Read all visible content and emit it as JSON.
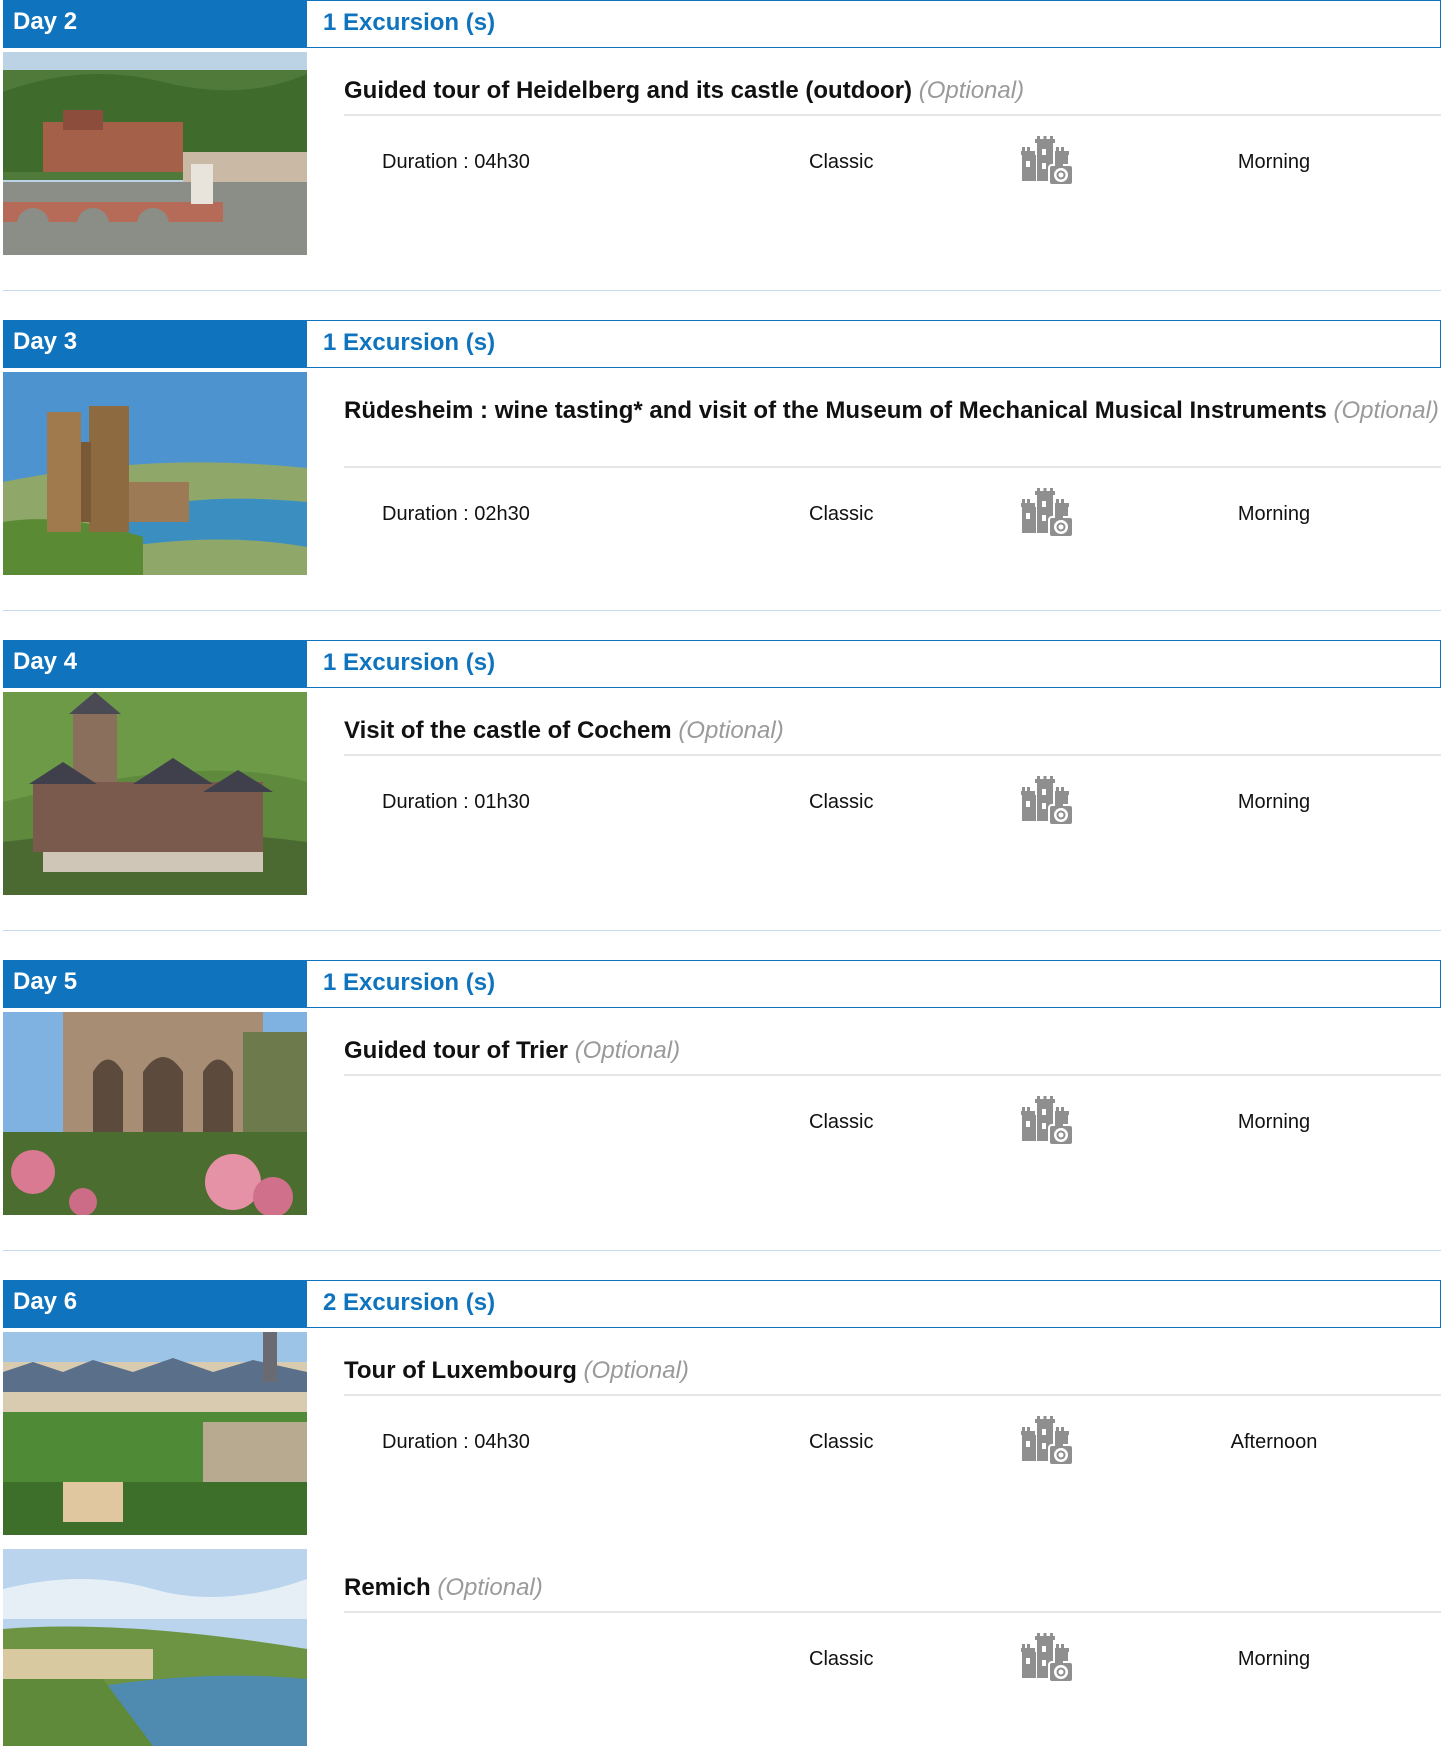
{
  "days": [
    {
      "label": "Day 2",
      "count": "1 Excursion (s)",
      "excursions": [
        {
          "title": "Guided tour of Heidelberg and its castle (outdoor)",
          "optional": "(Optional)",
          "duration": "Duration : 04h30",
          "level": "Classic",
          "icon": "castle-camera-icon",
          "time": "Morning"
        }
      ]
    },
    {
      "label": "Day 3",
      "count": "1 Excursion (s)",
      "excursions": [
        {
          "title": "Rüdesheim : wine tasting* and visit of the Museum of Mechanical Musical Instruments",
          "optional": "(Optional)",
          "duration": "Duration : 02h30",
          "level": "Classic",
          "icon": "castle-camera-icon",
          "time": "Morning"
        }
      ]
    },
    {
      "label": "Day 4",
      "count": "1 Excursion (s)",
      "excursions": [
        {
          "title": "Visit of the castle of Cochem",
          "optional": "(Optional)",
          "duration": "Duration : 01h30",
          "level": "Classic",
          "icon": "castle-camera-icon",
          "time": "Morning"
        }
      ]
    },
    {
      "label": "Day 5",
      "count": "1 Excursion (s)",
      "excursions": [
        {
          "title": "Guided tour of Trier",
          "optional": "(Optional)",
          "duration": "",
          "level": "Classic",
          "icon": "castle-camera-icon",
          "time": "Morning"
        }
      ]
    },
    {
      "label": "Day 6",
      "count": "2 Excursion (s)",
      "excursions": [
        {
          "title": "Tour of Luxembourg",
          "optional": "(Optional)",
          "duration": "Duration : 04h30",
          "level": "Classic",
          "icon": "castle-camera-icon",
          "time": "Afternoon"
        },
        {
          "title": "Remich",
          "optional": "(Optional)",
          "duration": "",
          "level": "Classic",
          "icon": "castle-camera-icon",
          "time": "Morning"
        }
      ]
    }
  ],
  "colors": {
    "accent": "#0f74bd",
    "optional": "#9a9a9a",
    "divider": "#e6e6e6"
  }
}
